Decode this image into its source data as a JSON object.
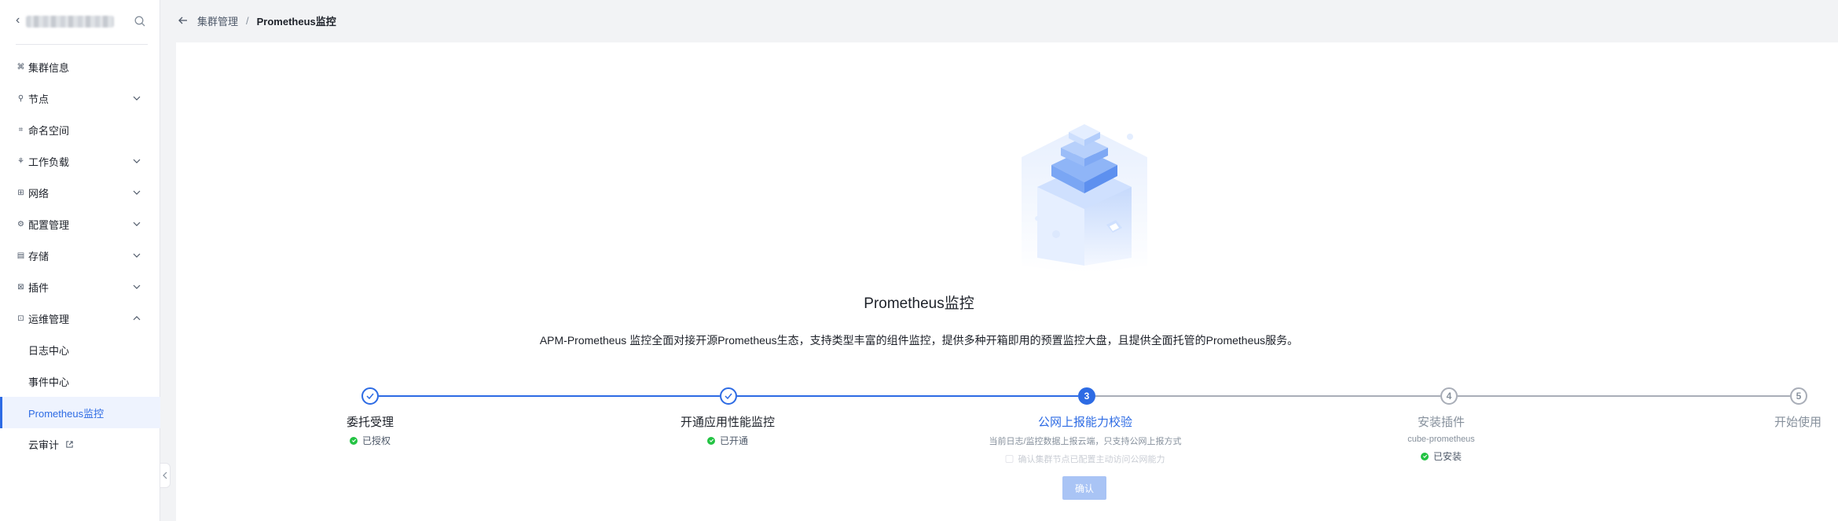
{
  "sidebar": {
    "items": [
      {
        "label": "集群信息",
        "icon": "cluster-info-icon",
        "expandable": false
      },
      {
        "label": "节点",
        "icon": "node-icon",
        "expandable": true
      },
      {
        "label": "命名空间",
        "icon": "namespace-icon",
        "expandable": false
      },
      {
        "label": "工作负载",
        "icon": "workload-icon",
        "expandable": true
      },
      {
        "label": "网络",
        "icon": "network-icon",
        "expandable": true
      },
      {
        "label": "配置管理",
        "icon": "config-icon",
        "expandable": true
      },
      {
        "label": "存储",
        "icon": "storage-icon",
        "expandable": true
      },
      {
        "label": "插件",
        "icon": "plugin-icon",
        "expandable": true
      },
      {
        "label": "运维管理",
        "icon": "ops-icon",
        "expandable": true,
        "expanded": true
      }
    ],
    "sub_items": [
      {
        "label": "日志中心"
      },
      {
        "label": "事件中心"
      },
      {
        "label": "Prometheus监控",
        "active": true
      },
      {
        "label": "云审计",
        "external": true
      }
    ]
  },
  "breadcrumb": {
    "parent": "集群管理",
    "separator": "/",
    "current": "Prometheus监控"
  },
  "main": {
    "title": "Prometheus监控",
    "description": "APM-Prometheus 监控全面对接开源Prometheus生态，支持类型丰富的组件监控，提供多种开箱即用的预置监控大盘，且提供全面托管的Prometheus服务。"
  },
  "steps": [
    {
      "number": "1",
      "label": "委托受理",
      "status": "done",
      "status_text": "已授权"
    },
    {
      "number": "2",
      "label": "开通应用性能监控",
      "status": "done",
      "status_text": "已开通"
    },
    {
      "number": "3",
      "label": "公网上报能力校验",
      "status": "current",
      "note": "当前日志/监控数据上报云端，只支持公网上报方式",
      "checkbox_label": "确认集群节点已配置主动访问公网能力",
      "button_label": "确认"
    },
    {
      "number": "4",
      "label": "安装插件",
      "status": "todo",
      "note": "cube-prometheus",
      "status_text": "已安装"
    },
    {
      "number": "5",
      "label": "开始使用",
      "status": "todo"
    }
  ],
  "colors": {
    "primary": "#2d6be4",
    "success": "#23c343",
    "muted": "#86909c",
    "active_bg": "#eef3fe"
  }
}
